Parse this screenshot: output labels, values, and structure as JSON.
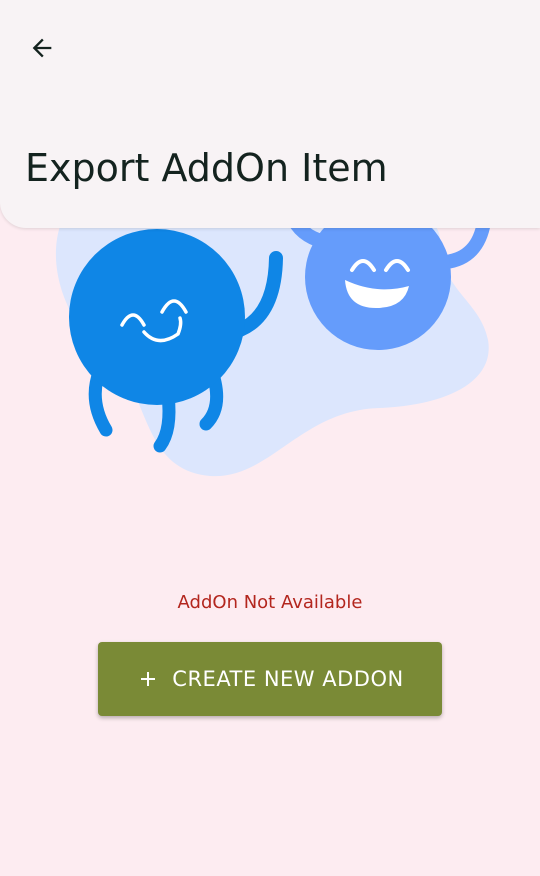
{
  "app_bar": {
    "back_icon": "arrow-left-icon",
    "title": "Export AddOn Item"
  },
  "illustration": {
    "description_icon": "two-happy-characters-illustration",
    "colors": {
      "blob": "#DCE6FD",
      "dark_blue": "#0F86E6",
      "light_blue": "#659CFB",
      "face": "#FFFFFF"
    }
  },
  "empty_state": {
    "message": "AddOn Not Available"
  },
  "create_button": {
    "icon": "plus-icon",
    "label": "CREATE NEW ADDON"
  },
  "colors": {
    "background": "#FDECF1",
    "app_bar": "#F8F3F5",
    "title_text": "#14231F",
    "error_text": "#B3261E",
    "button": "#7A8A36",
    "button_text": "#FFFFFF"
  }
}
